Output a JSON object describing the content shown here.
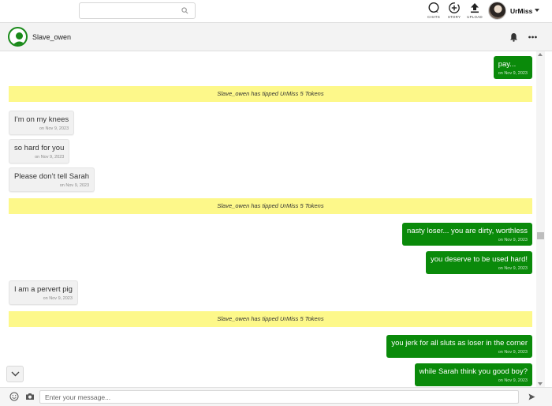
{
  "topbar": {
    "search_placeholder": "",
    "nav": [
      {
        "label": "CHATS",
        "icon": "chat-bubble-icon"
      },
      {
        "label": "STORY",
        "icon": "add-story-icon"
      },
      {
        "label": "UPLOAD",
        "icon": "upload-icon"
      }
    ],
    "username": "UrMiss"
  },
  "chat": {
    "contact_name": "Slave_owen",
    "messages": [
      {
        "dir": "out",
        "text": "pay...",
        "date": "on Nov 9, 2023"
      },
      {
        "dir": "tip",
        "text": "Slave_owen has tipped UrMiss 5 Tokens"
      },
      {
        "dir": "in",
        "text": "I’m on my knees",
        "date": "on Nov 9, 2023"
      },
      {
        "dir": "in",
        "text": "so hard for you",
        "date": "on Nov 9, 2023"
      },
      {
        "dir": "in",
        "text": "Please don’t tell Sarah",
        "date": "on Nov 9, 2023"
      },
      {
        "dir": "tip",
        "text": "Slave_owen has tipped UrMiss 5 Tokens"
      },
      {
        "dir": "out",
        "text": "nasty loser... you are dirty, worthless",
        "date": "on Nov 9, 2023"
      },
      {
        "dir": "out",
        "text": "you deserve to be used hard!",
        "date": "on Nov 9, 2023"
      },
      {
        "dir": "in",
        "text": "I am a pervert pig",
        "date": "on Nov 9, 2023"
      },
      {
        "dir": "tip",
        "text": "Slave_owen has tipped UrMiss 5 Tokens"
      },
      {
        "dir": "out",
        "text": "you jerk for all sluts as loser in the corner",
        "date": "on Nov 9, 2023"
      },
      {
        "dir": "out",
        "text": "while Sarah think you good boy?",
        "date": "on Nov 9, 2023"
      }
    ]
  },
  "composer": {
    "placeholder": "Enter your message..."
  },
  "colors": {
    "outgoing_bubble": "#0a8a0a",
    "incoming_bubble": "#f1f1f1",
    "tip_banner": "#fdf88a"
  }
}
